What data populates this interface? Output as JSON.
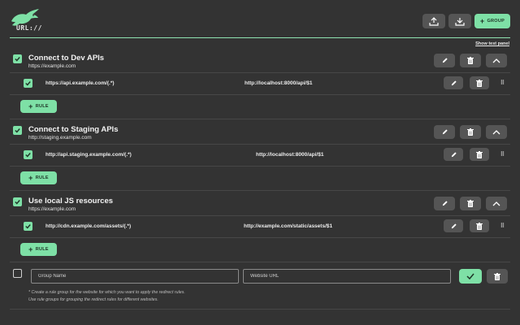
{
  "app": {
    "logo_text": "URL://"
  },
  "header": {
    "upload_icon": "upload-icon",
    "download_icon": "download-icon",
    "add_group_label": "GROUP",
    "show_test_panel": "Show test panel",
    "accent_color": "#7ee0a6"
  },
  "groups": [
    {
      "checked": true,
      "title": "Connect to Dev APIs",
      "url": "https://example.com",
      "rules": [
        {
          "checked": true,
          "from": "https://api.example.com/(.*)",
          "to": "http://localhost:8000/api/$1"
        }
      ],
      "add_rule_label": "RULE"
    },
    {
      "checked": true,
      "title": "Connect to Staging APIs",
      "url": "http://staging.example.com",
      "rules": [
        {
          "checked": true,
          "from": "http://api.staging.example.com/(.*)",
          "to": "http://localhost:8000/api/$1"
        }
      ],
      "add_rule_label": "RULE"
    },
    {
      "checked": true,
      "title": "Use local JS resources",
      "url": "https://example.com",
      "rules": [
        {
          "checked": true,
          "from": "http://cdn.example.com/assets/(.*)",
          "to": "http://example.com/static/assets/$1"
        }
      ],
      "add_rule_label": "RULE"
    }
  ],
  "new_group": {
    "checked": false,
    "name_placeholder": "Group Name",
    "url_placeholder": "Website URL",
    "note_line1": "* Create a rule group for the website for which you want to apply the redirect rules.",
    "note_line2": "Use rule groups for grouping the redirect rules for different websites."
  }
}
